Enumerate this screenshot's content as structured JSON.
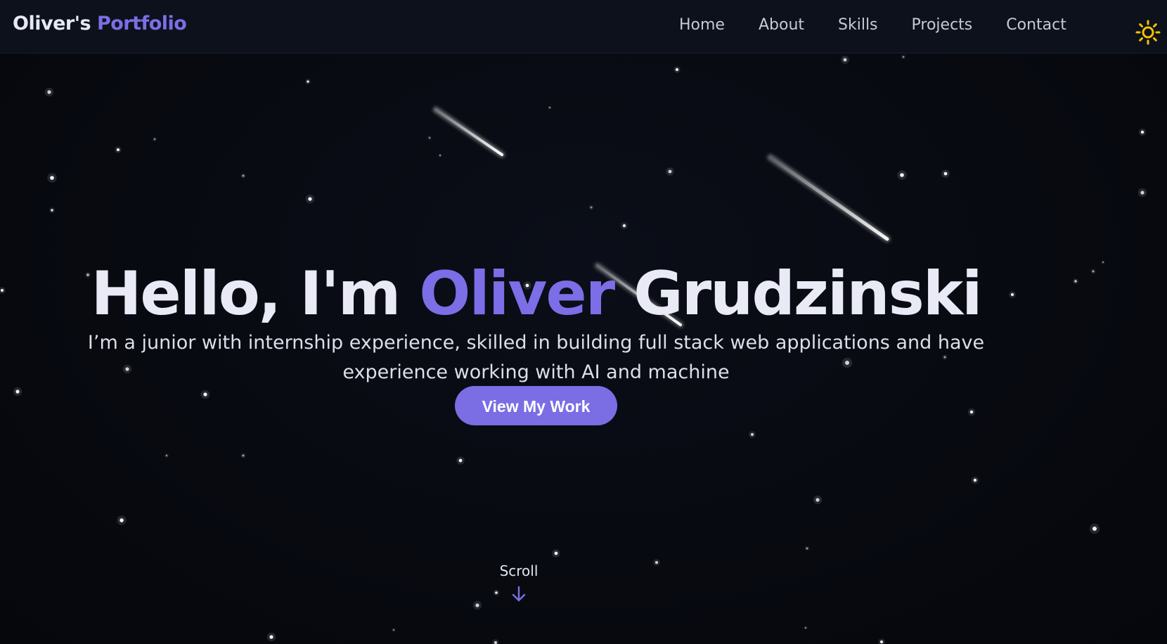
{
  "header": {
    "logo_main": "Oliver's",
    "logo_accent": "Portfolio",
    "nav": [
      {
        "label": "Home"
      },
      {
        "label": "About"
      },
      {
        "label": "Skills"
      },
      {
        "label": "Projects"
      },
      {
        "label": "Contact"
      }
    ],
    "theme_icon": "sun-icon"
  },
  "hero": {
    "greeting": "Hello, I'm ",
    "first_name": "Oliver",
    "last_name": " Grudzinski",
    "subtitle": "I’m a junior with internship experience, skilled in building full stack web applications and have experience working with AI and machine",
    "cta_label": "View My Work"
  },
  "scroll": {
    "label": "Scroll",
    "icon": "arrow-down-icon"
  },
  "colors": {
    "background": "#080a12",
    "navbar": "#0d111c",
    "accent": "#7c6ee6",
    "text": "#e9eaf5",
    "sun": "#f5c400"
  }
}
